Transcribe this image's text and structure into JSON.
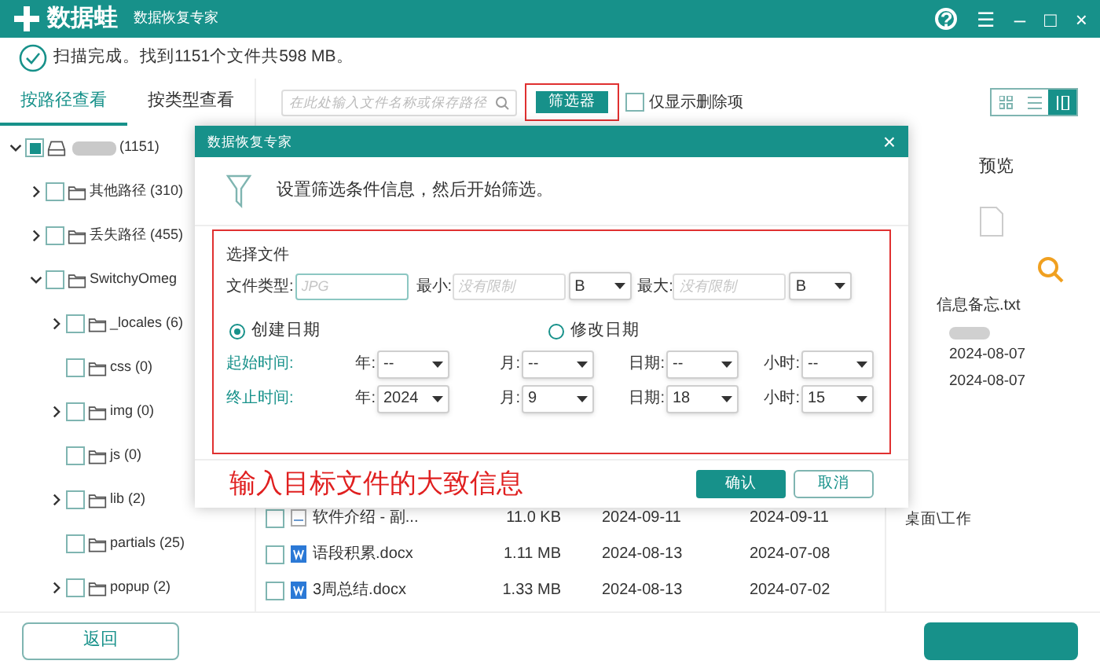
{
  "window": {
    "logo_text": "数据蛙",
    "title": "数据恢复专家",
    "controls": [
      "?",
      "☰",
      "–",
      "□",
      "×"
    ]
  },
  "status": {
    "text": "扫描完成。找到1151个文件共598 MB。"
  },
  "left_tabs": [
    {
      "label": "按路径查看",
      "selected": true
    },
    {
      "label": "按类型查看",
      "selected": false
    }
  ],
  "tree": [
    {
      "label": "(1151)",
      "kind": "drive",
      "checked": false,
      "partial": true,
      "expanded": true,
      "children": [
        {
          "label": "其他路径 (310)",
          "kind": "folder",
          "checked": false,
          "partial": false,
          "expanded": false
        },
        {
          "label": "丢失路径 (455)",
          "kind": "folder",
          "checked": false,
          "partial": false,
          "expanded": false
        },
        {
          "label": "SwitchyOmeg",
          "kind": "folder",
          "checked": false,
          "partial": false,
          "expanded": true,
          "children": [
            {
              "label": "_locales (6)",
              "kind": "folder",
              "checked": false,
              "partial": false,
              "expanded": false
            },
            {
              "label": "css (0)",
              "kind": "folder",
              "checked": false,
              "partial": false
            },
            {
              "label": "img (0)",
              "kind": "folder",
              "checked": false,
              "partial": false,
              "expanded": false
            },
            {
              "label": "js (0)",
              "kind": "folder",
              "checked": false,
              "partial": false
            },
            {
              "label": "lib (2)",
              "kind": "folder",
              "checked": false,
              "partial": false,
              "expanded": false
            },
            {
              "label": "partials (25)",
              "kind": "folder",
              "checked": false,
              "partial": false
            },
            {
              "label": "popup (2)",
              "kind": "folder",
              "checked": false,
              "partial": false,
              "expanded": false
            }
          ]
        }
      ]
    }
  ],
  "toolbar": {
    "search_placeholder": "在此处输入文件名称或保存路径",
    "filter_button": "筛选器",
    "deleted_only": {
      "label": "仅显示删除项",
      "checked": false
    },
    "views": [
      {
        "kind": "grid",
        "selected": false
      },
      {
        "kind": "list",
        "selected": false
      },
      {
        "kind": "detail",
        "selected": true
      }
    ]
  },
  "files": [
    {
      "name": "软件介绍 - 副...",
      "kind": "txt",
      "size": "11.0 KB",
      "created": "2024-09-11",
      "modified": "2024-09-11",
      "checked": false
    },
    {
      "name": "语段积累.docx",
      "kind": "docx",
      "size": "1.11 MB",
      "created": "2024-08-13",
      "modified": "2024-07-08",
      "checked": false
    },
    {
      "name": "3周总结.docx",
      "kind": "docx",
      "size": "1.33 MB",
      "created": "2024-08-13",
      "modified": "2024-07-02",
      "checked": false
    }
  ],
  "preview": {
    "title": "预览",
    "file_name": "信息备忘.txt",
    "details": [
      "2024-08-07",
      "2024-08-07",
      "桌面\\工作"
    ]
  },
  "back_button": "返回",
  "dialog": {
    "title": "数据恢复专家",
    "close": "×",
    "intro": "设置筛选条件信息，然后开始筛选。",
    "section": "选择文件",
    "file_type": {
      "label": "文件类型:",
      "placeholder": "JPG"
    },
    "min": {
      "label": "最小:",
      "placeholder": "没有限制",
      "unit": "B"
    },
    "max": {
      "label": "最大:",
      "placeholder": "没有限制",
      "unit": "B"
    },
    "date_modes": [
      {
        "label": "创建日期",
        "selected": true
      },
      {
        "label": "修改日期",
        "selected": false
      }
    ],
    "ranges": [
      {
        "label": "起始时间:",
        "fields": [
          {
            "label": "年:",
            "value": "--"
          },
          {
            "label": "月:",
            "value": "--"
          },
          {
            "label": "日期:",
            "value": "--"
          },
          {
            "label": "小时:",
            "value": "--"
          }
        ]
      },
      {
        "label": "终止时间:",
        "fields": [
          {
            "label": "年:",
            "value": "2024"
          },
          {
            "label": "月:",
            "value": "9"
          },
          {
            "label": "日期:",
            "value": "18"
          },
          {
            "label": "小时:",
            "value": "15"
          }
        ]
      }
    ],
    "annotation": "输入目标文件的大致信息",
    "confirm": "确认",
    "cancel": "取消"
  }
}
